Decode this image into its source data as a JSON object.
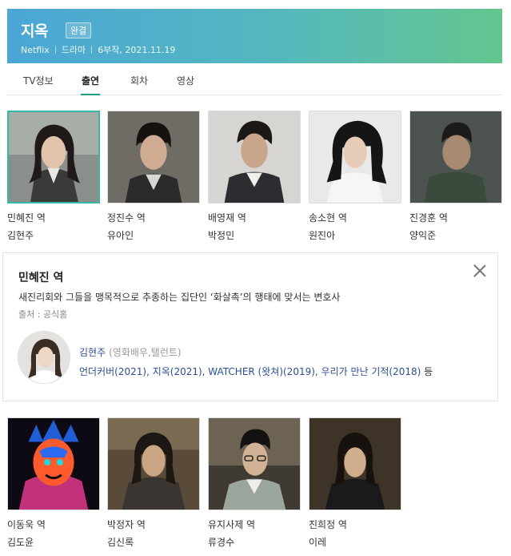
{
  "header": {
    "title": "지옥",
    "badge": "완결",
    "meta": [
      "Netflix",
      "드라마",
      "6부작, 2021.11.19"
    ]
  },
  "tabs": [
    "TV정보",
    "출연",
    "회차",
    "영상"
  ],
  "active_tab": "출연",
  "cast_row1": [
    {
      "role": "민혜진 역",
      "actor": "김현주"
    },
    {
      "role": "정진수 역",
      "actor": "유아인"
    },
    {
      "role": "배영재 역",
      "actor": "박정민"
    },
    {
      "role": "송소현 역",
      "actor": "원진아"
    },
    {
      "role": "진경훈 역",
      "actor": "양익준"
    }
  ],
  "detail": {
    "role_title": "민혜진 역",
    "description": "새진리회와 그들을 맹목적으로 추종하는 집단인 ‘화살촉’의 행태에 맞서는 변호사",
    "source": "출처 : 공식홈",
    "actor_name": "김현주",
    "actor_job": "(영화배우,탤런트)",
    "works": "언더커버(2021), 지옥(2021), WATCHER (왓쳐)(2019), 우리가 만난 기적(2018)",
    "works_suffix": "등"
  },
  "cast_row2": [
    {
      "role": "이동욱 역",
      "actor": "김도윤"
    },
    {
      "role": "박정자 역",
      "actor": "김신록"
    },
    {
      "role": "유지사제 역",
      "actor": "류경수"
    },
    {
      "role": "진희정 역",
      "actor": "이레"
    }
  ],
  "colors": {
    "accent": "#35b8a4",
    "link": "#2a4e9e",
    "header_start": "#4aa6d6",
    "header_end": "#63c68e"
  }
}
